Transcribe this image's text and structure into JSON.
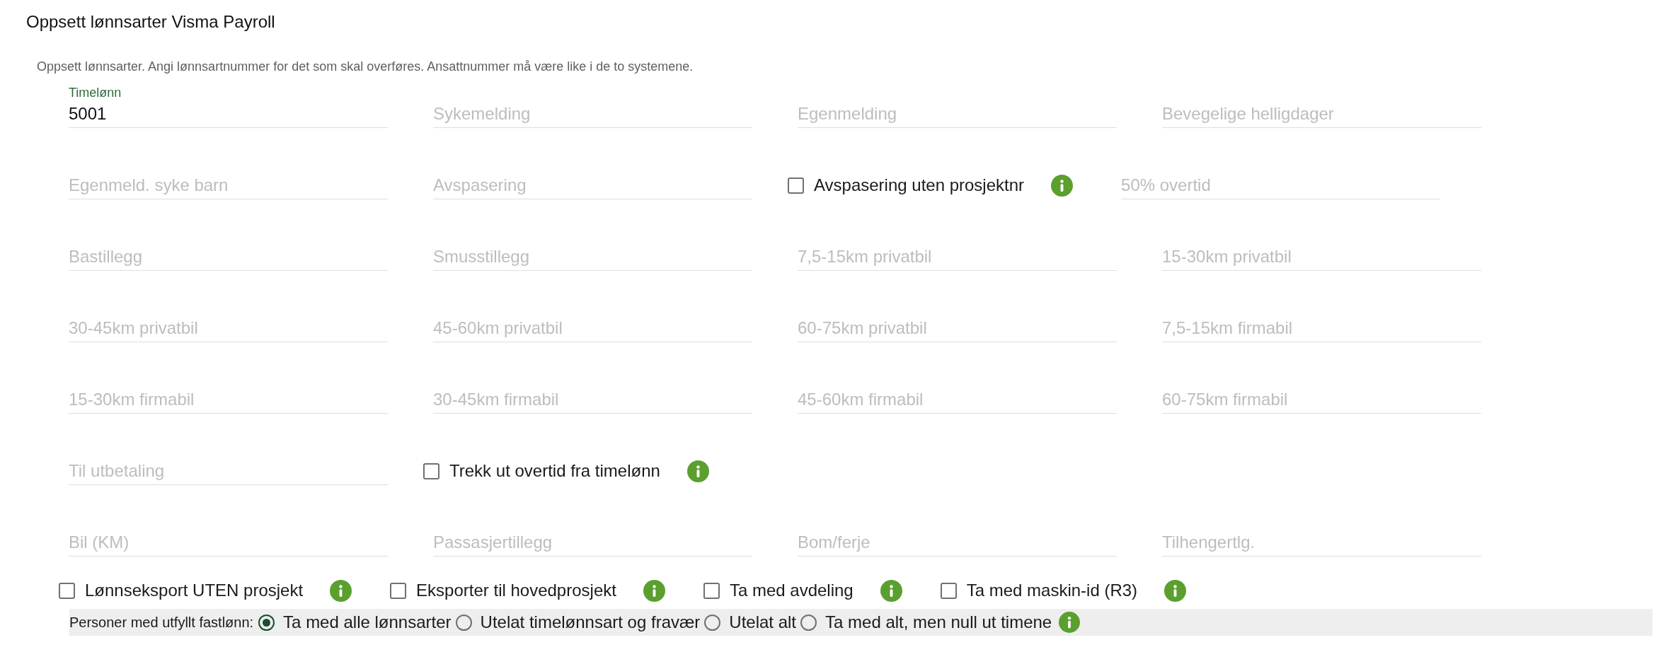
{
  "title": "Oppsett lønnsarter Visma Payroll",
  "description": "Oppsett lønnsarter. Angi lønnsartnummer for det som skal overføres. Ansattnummer må være like i de to systemene.",
  "rows": [
    {
      "items": [
        {
          "kind": "field",
          "label": "Timelønn",
          "value": "5001"
        },
        {
          "kind": "field",
          "placeholder": "Sykemelding"
        },
        {
          "kind": "field",
          "placeholder": "Egenmelding"
        },
        {
          "kind": "field",
          "placeholder": "Bevegelige helligdager"
        }
      ]
    },
    {
      "items": [
        {
          "kind": "field",
          "placeholder": "Egenmeld. syke barn"
        },
        {
          "kind": "field",
          "placeholder": "Avspasering"
        },
        {
          "kind": "checkbox",
          "label": "Avspasering uten prosjektnr",
          "checked": false,
          "info": true
        },
        {
          "kind": "field",
          "placeholder": "50% overtid"
        }
      ]
    },
    {
      "items": [
        {
          "kind": "field",
          "placeholder": "Bastillegg"
        },
        {
          "kind": "field",
          "placeholder": "Smusstillegg"
        },
        {
          "kind": "field",
          "placeholder": "7,5-15km privatbil"
        },
        {
          "kind": "field",
          "placeholder": "15-30km privatbil"
        }
      ]
    },
    {
      "items": [
        {
          "kind": "field",
          "placeholder": "30-45km privatbil"
        },
        {
          "kind": "field",
          "placeholder": "45-60km privatbil"
        },
        {
          "kind": "field",
          "placeholder": "60-75km privatbil"
        },
        {
          "kind": "field",
          "placeholder": "7,5-15km firmabil"
        }
      ]
    },
    {
      "items": [
        {
          "kind": "field",
          "placeholder": "15-30km firmabil"
        },
        {
          "kind": "field",
          "placeholder": "30-45km firmabil"
        },
        {
          "kind": "field",
          "placeholder": "45-60km firmabil"
        },
        {
          "kind": "field",
          "placeholder": "60-75km firmabil"
        }
      ]
    },
    {
      "items": [
        {
          "kind": "field",
          "placeholder": "Til utbetaling"
        },
        {
          "kind": "checkbox",
          "label": "Trekk ut overtid fra timelønn",
          "checked": false,
          "info": true
        }
      ]
    },
    {
      "items": [
        {
          "kind": "field",
          "placeholder": "Bil (KM)"
        },
        {
          "kind": "field",
          "placeholder": "Passasjertillegg"
        },
        {
          "kind": "field",
          "placeholder": "Bom/ferje"
        },
        {
          "kind": "field",
          "placeholder": "Tilhengertlg."
        }
      ]
    }
  ],
  "options": [
    {
      "label": "Lønnseksport UTEN prosjekt",
      "checked": false,
      "info": true
    },
    {
      "label": "Eksporter til hovedprosjekt",
      "checked": false,
      "info": true
    },
    {
      "label": "Ta med avdeling",
      "checked": false,
      "info": true
    },
    {
      "label": "Ta med maskin-id (R3)",
      "checked": false,
      "info": true
    }
  ],
  "fixed_salary": {
    "label": "Personer med utfyllt fastlønn:",
    "choices": [
      {
        "label": "Ta med alle lønnsarter",
        "selected": true
      },
      {
        "label": "Utelat timelønnsart og fravær",
        "selected": false
      },
      {
        "label": "Utelat alt",
        "selected": false
      },
      {
        "label": "Ta med alt, men null ut timene",
        "selected": false
      }
    ],
    "info": true
  }
}
